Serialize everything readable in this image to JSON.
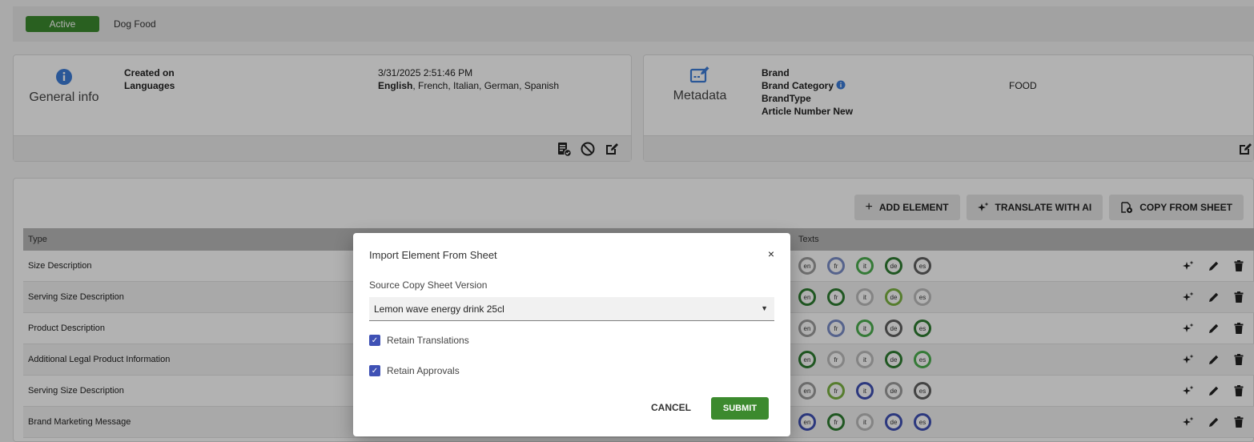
{
  "status": {
    "badge": "Active",
    "name": "Dog Food"
  },
  "general": {
    "title": "General info",
    "labels": [
      "Created on",
      "Languages"
    ],
    "created_on": "3/31/2025 2:51:46 PM",
    "languages_primary": "English",
    "languages_rest": ", French, Italian, German, Spanish"
  },
  "metadata": {
    "title": "Metadata",
    "labels": [
      "Brand",
      "Brand Category",
      "BrandType",
      "Article Number New"
    ],
    "brand_category_value": "FOOD"
  },
  "toolbar": {
    "add_element": "ADD ELEMENT",
    "translate_ai": "TRANSLATE WITH AI",
    "copy_from_sheet": "COPY FROM SHEET"
  },
  "table": {
    "col_type": "Type",
    "col_texts": "Texts",
    "rows": [
      {
        "type": "Size Description",
        "langs": [
          [
            "en",
            "#9e9e9e"
          ],
          [
            "fr",
            "#7b8fc9"
          ],
          [
            "it",
            "#4caf50"
          ],
          [
            "de",
            "#2e7d32"
          ],
          [
            "es",
            "#616161"
          ]
        ]
      },
      {
        "type": "Serving Size Description",
        "langs": [
          [
            "en",
            "#2e7d32"
          ],
          [
            "fr",
            "#2e7d32"
          ],
          [
            "it",
            "#bdbdbd"
          ],
          [
            "de",
            "#7cb342"
          ],
          [
            "es",
            "#bdbdbd"
          ]
        ]
      },
      {
        "type": "Product Description",
        "langs": [
          [
            "en",
            "#9e9e9e"
          ],
          [
            "fr",
            "#7b8fc9"
          ],
          [
            "it",
            "#4caf50"
          ],
          [
            "de",
            "#616161"
          ],
          [
            "es",
            "#2e7d32"
          ]
        ]
      },
      {
        "type": "Additional Legal Product Information",
        "langs": [
          [
            "en",
            "#2e7d32"
          ],
          [
            "fr",
            "#bdbdbd"
          ],
          [
            "it",
            "#bdbdbd"
          ],
          [
            "de",
            "#2e7d32"
          ],
          [
            "es",
            "#4caf50"
          ]
        ]
      },
      {
        "type": "Serving Size Description",
        "langs": [
          [
            "en",
            "#9e9e9e"
          ],
          [
            "fr",
            "#7cb342"
          ],
          [
            "it",
            "#3f51b5"
          ],
          [
            "de",
            "#9e9e9e"
          ],
          [
            "es",
            "#616161"
          ]
        ]
      },
      {
        "type": "Brand Marketing Message",
        "langs": [
          [
            "en",
            "#3f51b5"
          ],
          [
            "fr",
            "#2e7d32"
          ],
          [
            "it",
            "#bdbdbd"
          ],
          [
            "de",
            "#3f51b5"
          ],
          [
            "es",
            "#3f51b5"
          ]
        ]
      }
    ]
  },
  "modal": {
    "title": "Import Element From Sheet",
    "close": "×",
    "source_label": "Source Copy Sheet Version",
    "source_value": "Lemon wave energy drink 25cl",
    "retain_translations": "Retain Translations",
    "retain_approvals": "Retain Approvals",
    "cancel": "CANCEL",
    "submit": "SUBMIT"
  },
  "colors": {
    "green": "#3c8a2e",
    "blue": "#3f51b5",
    "info_blue": "#3d7dd8"
  }
}
